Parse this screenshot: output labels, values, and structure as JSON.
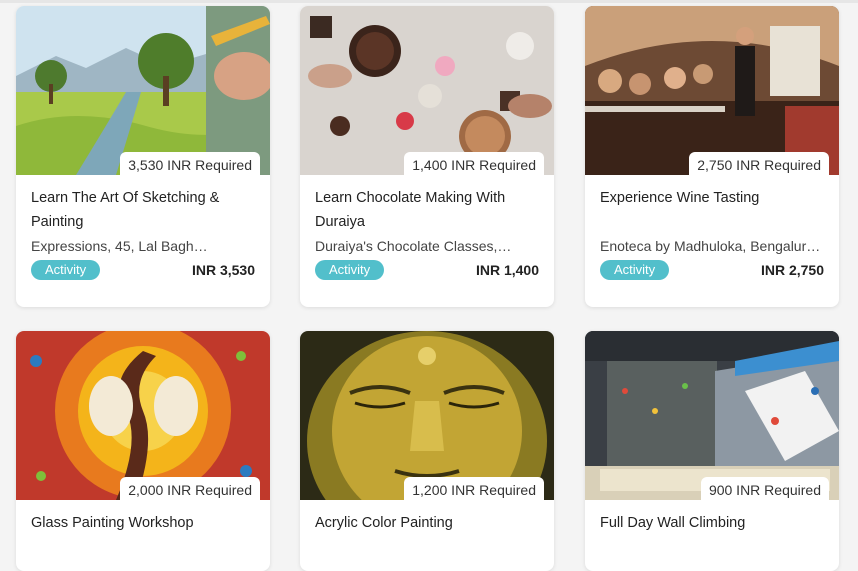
{
  "cards": [
    {
      "required": "3,530 INR Required",
      "title": "Learn The Art Of Sketching & Painting",
      "location": "Expressions, 45, Lal Bagh…",
      "badge": "Activity",
      "price": "INR 3,530"
    },
    {
      "required": "1,400 INR Required",
      "title": "Learn Chocolate Making With Duraiya",
      "location": "Duraiya's Chocolate Classes,…",
      "badge": "Activity",
      "price": "INR 1,400"
    },
    {
      "required": "2,750 INR Required",
      "title": "Experience Wine Tasting",
      "location": "Enoteca by Madhuloka, Bengaluru…",
      "badge": "Activity",
      "price": "INR 2,750"
    },
    {
      "required": "2,000 INR Required",
      "title": "Glass Painting Workshop"
    },
    {
      "required": "1,200 INR Required",
      "title": "Acrylic Color Painting"
    },
    {
      "required": "900 INR Required",
      "title": "Full Day Wall Climbing"
    }
  ],
  "colors": {
    "badge": "#52bfcb",
    "card_bg": "#ffffff",
    "page_bg": "#f4f4f4"
  }
}
